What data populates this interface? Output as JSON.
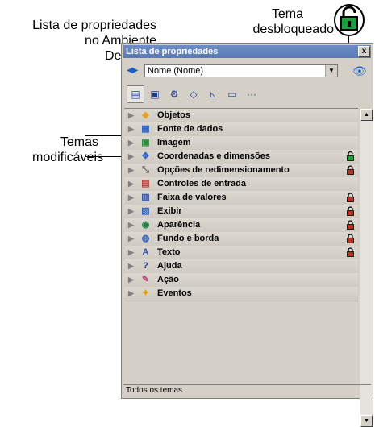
{
  "callouts": {
    "property_list_line1": "Lista de propriedades",
    "property_list_line2": "no Ambiente",
    "property_list_line3": "Desenho",
    "unlocked_theme_line1": "Tema",
    "unlocked_theme_line2": "desbloqueado",
    "modifiable_themes_line1": "Temas",
    "modifiable_themes_line2": "modificáveis"
  },
  "panel": {
    "title": "Lista de propriedades",
    "close_label": "x",
    "object_selector": {
      "value": "Nome (Nome)"
    },
    "toolbar_icons": [
      "list-icon",
      "appearance-icon",
      "gear-icon",
      "shapes-icon",
      "chart-icon",
      "monitor-icon",
      "more-icon"
    ],
    "themes": [
      {
        "label": "Objetos",
        "icon": "cube-icon",
        "lock": "none"
      },
      {
        "label": "Fonte de dados",
        "icon": "database-icon",
        "lock": "none"
      },
      {
        "label": "Imagem",
        "icon": "image-icon",
        "lock": "none"
      },
      {
        "label": "Coordenadas e dimensões",
        "icon": "move-icon",
        "lock": "unlocked"
      },
      {
        "label": "Opções de redimensionamento",
        "icon": "resize-icon",
        "lock": "locked"
      },
      {
        "label": "Controles de entrada",
        "icon": "input-icon",
        "lock": "none"
      },
      {
        "label": "Faixa de valores",
        "icon": "range-icon",
        "lock": "locked"
      },
      {
        "label": "Exibir",
        "icon": "display-icon",
        "lock": "locked"
      },
      {
        "label": "Aparência",
        "icon": "eye-icon",
        "lock": "locked"
      },
      {
        "label": "Fundo e borda",
        "icon": "fill-icon",
        "lock": "locked"
      },
      {
        "label": "Texto",
        "icon": "text-icon",
        "lock": "locked"
      },
      {
        "label": "Ajuda",
        "icon": "help-icon",
        "lock": "none"
      },
      {
        "label": "Ação",
        "icon": "action-icon",
        "lock": "none"
      },
      {
        "label": "Eventos",
        "icon": "events-icon",
        "lock": "none"
      }
    ],
    "status": "Todos os temas"
  },
  "colors": {
    "title_bar": "#5f80bc",
    "lock_locked": "#c03020",
    "lock_unlocked": "#20a030"
  }
}
